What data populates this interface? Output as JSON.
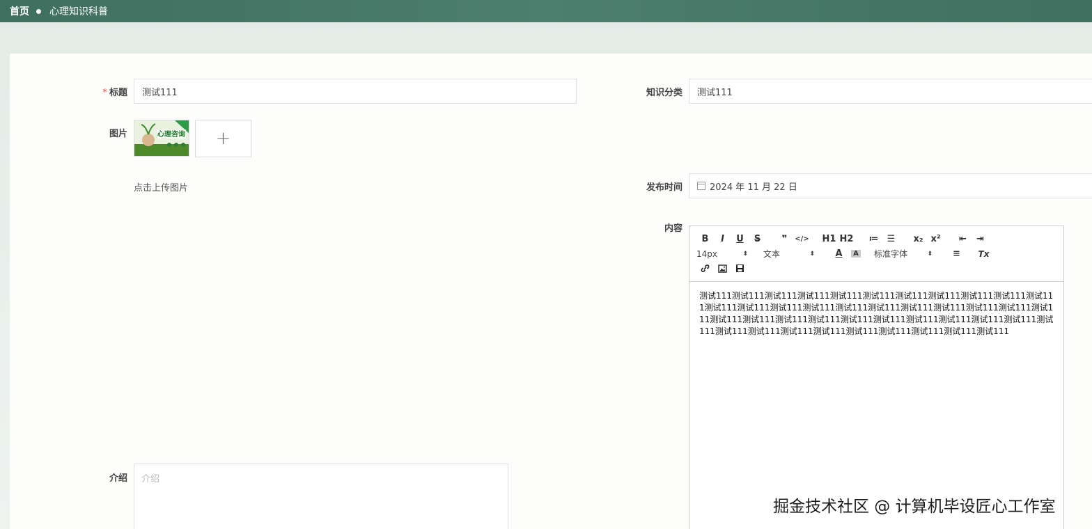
{
  "breadcrumb": {
    "home": "首页",
    "current": "心理知识科普"
  },
  "form": {
    "title_label": "标题",
    "title_required_mark": "*",
    "title_value": "测试111",
    "category_label": "知识分类",
    "category_value": "测试111",
    "image_label": "图片",
    "upload_plus": "+",
    "upload_hint": "点击上传图片",
    "thumbnail_text": "心理咨询",
    "publish_label": "发布时间",
    "publish_value": "2024 年 11 月 22 日",
    "content_label": "内容",
    "intro_label": "介绍",
    "intro_placeholder": "介绍"
  },
  "editor": {
    "toolbar_row1": [
      "B",
      "I",
      "U",
      "S",
      "❞",
      "</>",
      "H1",
      "H2",
      "≔",
      "☰",
      "x₂",
      "x²",
      "⇤",
      "⇥"
    ],
    "font_size": "14px",
    "block_type": "文本",
    "font_family": "标准字体",
    "toolbar_row2_icons": [
      "A",
      "A",
      "≡",
      "Tx"
    ],
    "toolbar_row3_icons": [
      "link-icon",
      "image-icon",
      "video-icon"
    ],
    "content": "测试111测试111测试111测试111测试111测试111测试111测试111测试111测试111测试111测试111测试111测试111测试111测试111测试111测试111测试111测试111测试111测试111测试111测试111测试111测试111测试111测试111测试111测试111测试111测试111测试111测试111测试111测试111测试111测试111测试111测试111测试111测试111"
  },
  "watermark": "掘金技术社区 @ 计算机毕设匠心工作室"
}
